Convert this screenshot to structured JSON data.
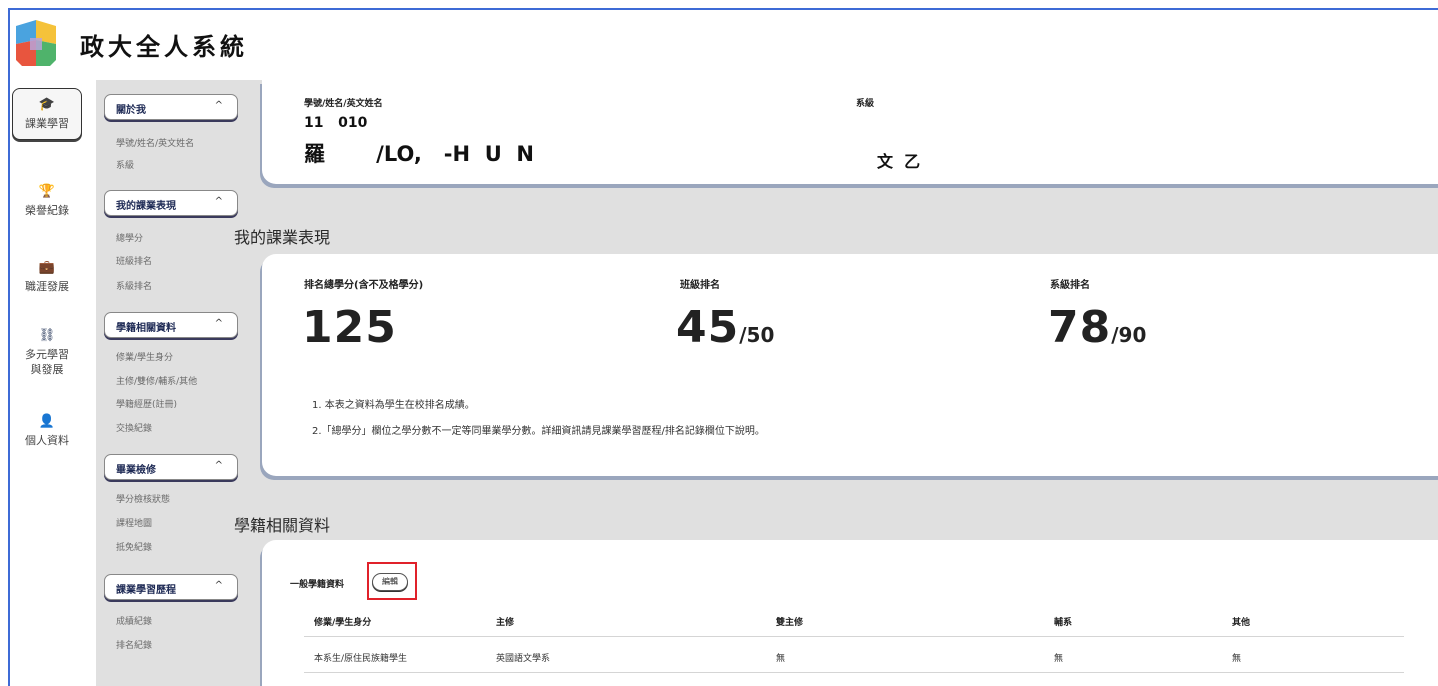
{
  "app": {
    "title": "政大全人系統"
  },
  "rail": [
    {
      "icon": "graduation-cap-icon",
      "glyph": "🎓",
      "label": "課業學習",
      "active": true
    },
    {
      "icon": "trophy-icon",
      "glyph": "🏆",
      "label": "榮譽紀錄"
    },
    {
      "icon": "briefcase-icon",
      "glyph": "💼",
      "label": "職涯發展"
    },
    {
      "icon": "network-icon",
      "glyph": "⛓",
      "label_line1": "多元學習",
      "label_line2": "與發展"
    },
    {
      "icon": "person-icon",
      "glyph": "👤",
      "label": "個人資料"
    }
  ],
  "submenu": {
    "groups": [
      {
        "title": "關於我",
        "links": [
          "學號/姓名/英文姓名",
          "系級"
        ]
      },
      {
        "title": "我的課業表現",
        "links": [
          "總學分",
          "班級排名",
          "系級排名"
        ]
      },
      {
        "title": "學籍相關資料",
        "links": [
          "修業/學生身分",
          "主修/雙修/輔系/其他",
          "學籍經歷(註冊)",
          "交換紀錄"
        ]
      },
      {
        "title": "畢業檢修",
        "links": [
          "學分檢核狀態",
          "課程地圖",
          "抵免紀錄"
        ]
      },
      {
        "title": "課業學習歷程",
        "links": [
          "成績紀錄",
          "排名紀錄"
        ]
      }
    ],
    "chevron": "^"
  },
  "profile": {
    "id_label": "學號/姓名/英文姓名",
    "id_value": "11   010",
    "name_value": "羅       /LO,   -H  U  N",
    "dept_label": "系級",
    "dept_value": "文  乙"
  },
  "performance": {
    "section_title": "我的課業表現",
    "credits_label": "排名總學分(含不及格學分)",
    "credits_value": "125",
    "class_rank_label": "班級排名",
    "class_rank_value": "45",
    "class_rank_total": "/50",
    "dept_rank_label": "系級排名",
    "dept_rank_value": "78",
    "dept_rank_total": "/90",
    "note1": "1. 本表之資料為學生在校排名成績。",
    "note2": "2.「總學分」欄位之學分數不一定等同畢業學分數。詳細資訊請見課業學習歷程/排名記錄欄位下說明。"
  },
  "registry": {
    "section_title": "學籍相關資料",
    "subtitle": "一般學籍資料",
    "edit_label": "編輯",
    "columns": [
      "修業/學生身分",
      "主修",
      "雙主修",
      "輔系",
      "其他"
    ],
    "rows": [
      [
        "本系生/原住民族籍學生",
        "英國語文學系",
        "無",
        "無",
        "無"
      ]
    ]
  }
}
